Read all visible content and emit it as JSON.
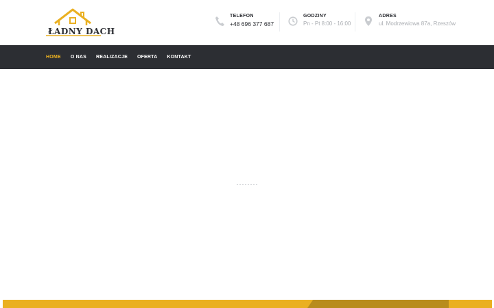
{
  "brand": {
    "logo_text": "ŁADNY DACH"
  },
  "header": {
    "phone": {
      "label": "TELEFON",
      "value": "+48 696 377 687",
      "icon": "phone-icon"
    },
    "hours": {
      "label": "GODZINY",
      "value": "Pn - Pt 8:00 - 16:00",
      "icon": "clock-icon"
    },
    "address": {
      "label": "ADRES",
      "value": "ul. Modrzewiowa 87a, Rzeszów",
      "icon": "map-pin-icon"
    }
  },
  "nav": {
    "items": [
      {
        "label": "HOME",
        "active": true
      },
      {
        "label": "O NAS",
        "active": false
      },
      {
        "label": "REALIZACJE",
        "active": false
      },
      {
        "label": "OFERTA",
        "active": false
      },
      {
        "label": "KONTAKT",
        "active": false
      }
    ]
  },
  "colors": {
    "accent": "#eab021",
    "accent_dark": "#b88c1c",
    "navbar": "#2c2e33",
    "muted_text": "#a9acb1"
  }
}
